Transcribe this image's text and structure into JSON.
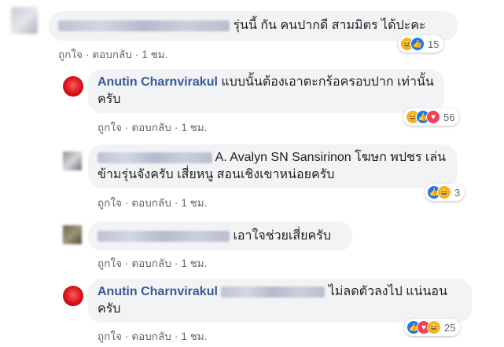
{
  "labels": {
    "like": "ถูกใจ",
    "reply": "ตอบกลับ",
    "sep": "·"
  },
  "colors": {
    "author": "#385898",
    "bubble": "#f2f3f5",
    "meta": "#606770",
    "like": "#1877f2",
    "love": "#f33e58",
    "haha": "#f7b125"
  },
  "comments": [
    {
      "author": "",
      "text": "รุ่นนี้ กัน คนปากดี สามมิตร ได้ปะคะ",
      "time": "1 ชม.",
      "reactions": [
        "haha-icon",
        "like-icon"
      ],
      "reaction_count": "15"
    },
    {
      "author": "Anutin Charnvirakul",
      "text": "แบบนั้นต้องเอาตะกร้อครอบปาก เท่านั้นครับ",
      "time": "1 ชม.",
      "reactions": [
        "haha-icon",
        "like-icon",
        "love-icon"
      ],
      "reaction_count": "56"
    },
    {
      "author": "",
      "tag": "A. Avalyn SN Sansirinon",
      "text": "โฆษก พปชร เล่นข้ามรุ่นจังครับ เสี่ยหนู สอนเชิงเขาหน่อยครับ",
      "time": "1 ชม.",
      "reactions": [
        "like-icon",
        "haha-icon"
      ],
      "reaction_count": "3"
    },
    {
      "author": "",
      "text": "เอาใจช่วยเสี่ยครับ",
      "time": "1 ชม.",
      "reactions": [],
      "reaction_count": ""
    },
    {
      "author": "Anutin Charnvirakul",
      "text": "ไม่ลดตัวลงไป แน่นอนครับ",
      "time": "1 ชม.",
      "reactions": [
        "like-icon",
        "love-icon",
        "haha-icon"
      ],
      "reaction_count": "25"
    }
  ]
}
